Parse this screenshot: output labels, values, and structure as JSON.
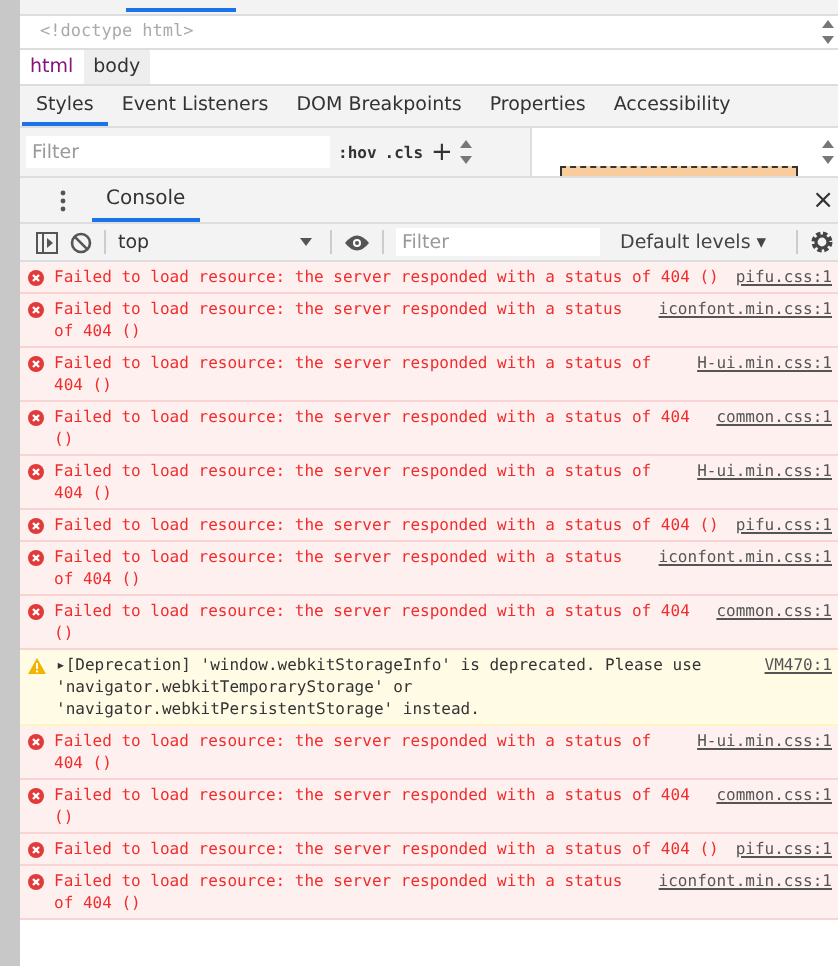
{
  "dom_tree": {
    "line": "<!doctype html>"
  },
  "breadcrumbs": [
    {
      "label": "html",
      "selected": false
    },
    {
      "label": "body",
      "selected": true
    }
  ],
  "style_tabs": [
    {
      "label": "Styles",
      "selected": true
    },
    {
      "label": "Event Listeners",
      "selected": false
    },
    {
      "label": "DOM Breakpoints",
      "selected": false
    },
    {
      "label": "Properties",
      "selected": false
    },
    {
      "label": "Accessibility",
      "selected": false
    }
  ],
  "styles_toolbar": {
    "filter_placeholder": "Filter",
    "hov": ":hov",
    "cls": ".cls",
    "add": "+"
  },
  "drawer": {
    "tab": {
      "label": "Console",
      "selected": true
    },
    "close": "×"
  },
  "console_toolbar": {
    "context": "top",
    "filter_placeholder": "Filter",
    "levels": "Default levels ▾"
  },
  "messages": [
    {
      "kind": "error",
      "text": "Failed to load resource: the server responded with a status of 404 ()",
      "source": "pifu.css:1"
    },
    {
      "kind": "error",
      "text": "Failed to load resource: the server responded with a status of 404 ()",
      "source": "iconfont.min.css:1"
    },
    {
      "kind": "error",
      "text": "Failed to load resource: the server responded with a status of 404 ()",
      "source": "H-ui.min.css:1"
    },
    {
      "kind": "error",
      "text": "Failed to load resource: the server responded with a status of 404 ()",
      "source": "common.css:1"
    },
    {
      "kind": "error",
      "text": "Failed to load resource: the server responded with a status of 404 ()",
      "source": "H-ui.min.css:1"
    },
    {
      "kind": "error",
      "text": "Failed to load resource: the server responded with a status of 404 ()",
      "source": "pifu.css:1"
    },
    {
      "kind": "error",
      "text": "Failed to load resource: the server responded with a status of 404 ()",
      "source": "iconfont.min.css:1"
    },
    {
      "kind": "error",
      "text": "Failed to load resource: the server responded with a status of 404 ()",
      "source": "common.css:1"
    },
    {
      "kind": "warning",
      "text": "▸[Deprecation] 'window.webkitStorageInfo' is deprecated. Please use 'navigator.webkitTemporaryStorage' or 'navigator.webkitPersistentStorage' instead.",
      "source": "VM470:1"
    },
    {
      "kind": "error",
      "text": "Failed to load resource: the server responded with a status of 404 ()",
      "source": "H-ui.min.css:1"
    },
    {
      "kind": "error",
      "text": "Failed to load resource: the server responded with a status of 404 ()",
      "source": "common.css:1"
    },
    {
      "kind": "error",
      "text": "Failed to load resource: the server responded with a status of 404 ()",
      "source": "pifu.css:1"
    },
    {
      "kind": "error",
      "text": "Failed to load resource: the server responded with a status of 404 ()",
      "source": "iconfont.min.css:1"
    }
  ]
}
